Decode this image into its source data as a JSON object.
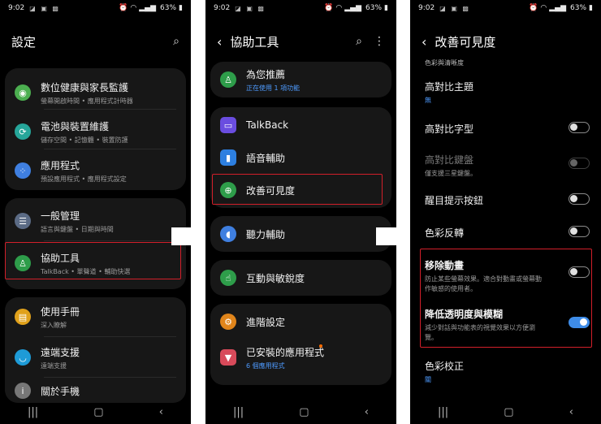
{
  "status": {
    "time": "9:02",
    "battery": "63%"
  },
  "screen1": {
    "title": "設定",
    "items": [
      {
        "label": "數位健康與家長監護",
        "sub": "螢幕開啟時間 • 應用程式計時器"
      },
      {
        "label": "電池與裝置維護",
        "sub": "儲存空間 • 記憶體 • 裝置防護"
      },
      {
        "label": "應用程式",
        "sub": "預設應用程式 • 應用程式設定"
      },
      {
        "label": "一般管理",
        "sub": "語言與鍵盤 • 日期與時間"
      },
      {
        "label": "協助工具",
        "sub": "TalkBack • 單聲道 • 輔助快選"
      },
      {
        "label": "使用手冊",
        "sub": "深入瞭解"
      },
      {
        "label": "遠端支援",
        "sub": "遠端支援"
      },
      {
        "label": "關於手機",
        "sub": ""
      }
    ]
  },
  "screen2": {
    "title": "協助工具",
    "items": [
      {
        "label": "為您推薦",
        "sub": "正在使用 1 項功能"
      },
      {
        "label": "TalkBack"
      },
      {
        "label": "語音輔助"
      },
      {
        "label": "改善可見度"
      },
      {
        "label": "聽力輔助"
      },
      {
        "label": "互動與敏銳度"
      },
      {
        "label": "進階設定"
      },
      {
        "label": "已安裝的應用程式",
        "sub": "6 個應用程式"
      }
    ]
  },
  "screen3": {
    "title": "改善可見度",
    "section": "色彩與清晰度",
    "items": [
      {
        "label": "高對比主題",
        "sub": "無"
      },
      {
        "label": "高對比字型"
      },
      {
        "label": "高對比鍵盤",
        "sub": "僅支援三星鍵盤。"
      },
      {
        "label": "醒目提示按鈕"
      },
      {
        "label": "色彩反轉"
      },
      {
        "label": "移除動畫",
        "sub1": "防止某些螢幕效果。適合對動畫或螢幕動",
        "sub2": "作敏感的使用者。"
      },
      {
        "label": "降低透明度與模糊",
        "sub1": "減少對話與功能表的視覺效果以方便瀏",
        "sub2": "覽。"
      },
      {
        "label": "色彩校正",
        "sub": "關"
      }
    ]
  },
  "colors": {
    "highlight": "#d21f2a",
    "toggle_on": "#3e8ce8",
    "link": "#4e9bff"
  }
}
